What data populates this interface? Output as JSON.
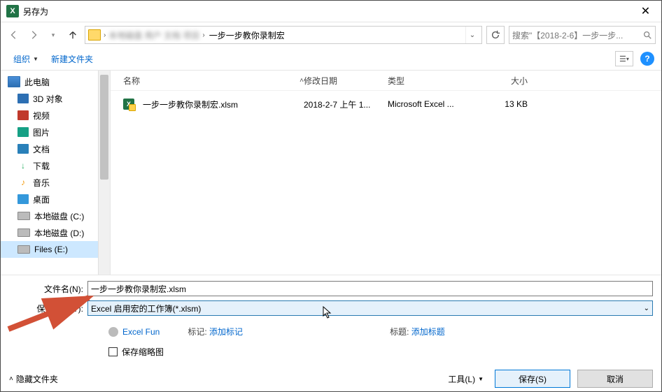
{
  "window": {
    "title": "另存为"
  },
  "nav": {
    "blurred_prefix": "本地磁盘  用户  文档  项目",
    "last_segment": "一步一步教你录制宏",
    "search_placeholder": "搜索\"【2018-2-6】一步一步..."
  },
  "toolbar": {
    "organize": "组织",
    "new_folder": "新建文件夹"
  },
  "sidebar": {
    "items": [
      {
        "label": "此电脑",
        "icon": "ico-monitor",
        "name": "this-pc",
        "root": true
      },
      {
        "label": "3D 对象",
        "icon": "ico-3d",
        "name": "3d-objects"
      },
      {
        "label": "视频",
        "icon": "ico-video",
        "name": "videos"
      },
      {
        "label": "图片",
        "icon": "ico-pic",
        "name": "pictures"
      },
      {
        "label": "文档",
        "icon": "ico-doc",
        "name": "documents"
      },
      {
        "label": "下载",
        "icon": "ico-down",
        "name": "downloads",
        "glyph": "↓"
      },
      {
        "label": "音乐",
        "icon": "ico-music",
        "name": "music",
        "glyph": "♪"
      },
      {
        "label": "桌面",
        "icon": "ico-desk",
        "name": "desktop"
      },
      {
        "label": "本地磁盘 (C:)",
        "icon": "ico-drive",
        "name": "drive-c"
      },
      {
        "label": "本地磁盘 (D:)",
        "icon": "ico-drive",
        "name": "drive-d"
      },
      {
        "label": "Files (E:)",
        "icon": "ico-drive",
        "name": "drive-e",
        "selected": true
      }
    ]
  },
  "filelist": {
    "headers": {
      "name": "名称",
      "date": "修改日期",
      "type": "类型",
      "size": "大小"
    },
    "rows": [
      {
        "name": "一步一步教你录制宏.xlsm",
        "date": "2018-2-7 上午 1...",
        "type": "Microsoft Excel ...",
        "size": "13 KB"
      }
    ]
  },
  "form": {
    "filename_label": "文件名(N):",
    "filename_value": "一步一步教你录制宏.xlsm",
    "savetype_label": "保存类型(T):",
    "savetype_value": "Excel 启用宏的工作簿(*.xlsm)",
    "author_value": "Excel Fun",
    "tag_label": "标记:",
    "tag_link": "添加标记",
    "title_label": "标题:",
    "title_link": "添加标题",
    "thumbnail_label": "保存缩略图"
  },
  "footer": {
    "hide_folders": "隐藏文件夹",
    "tools": "工具(L)",
    "save": "保存(S)",
    "cancel": "取消"
  }
}
